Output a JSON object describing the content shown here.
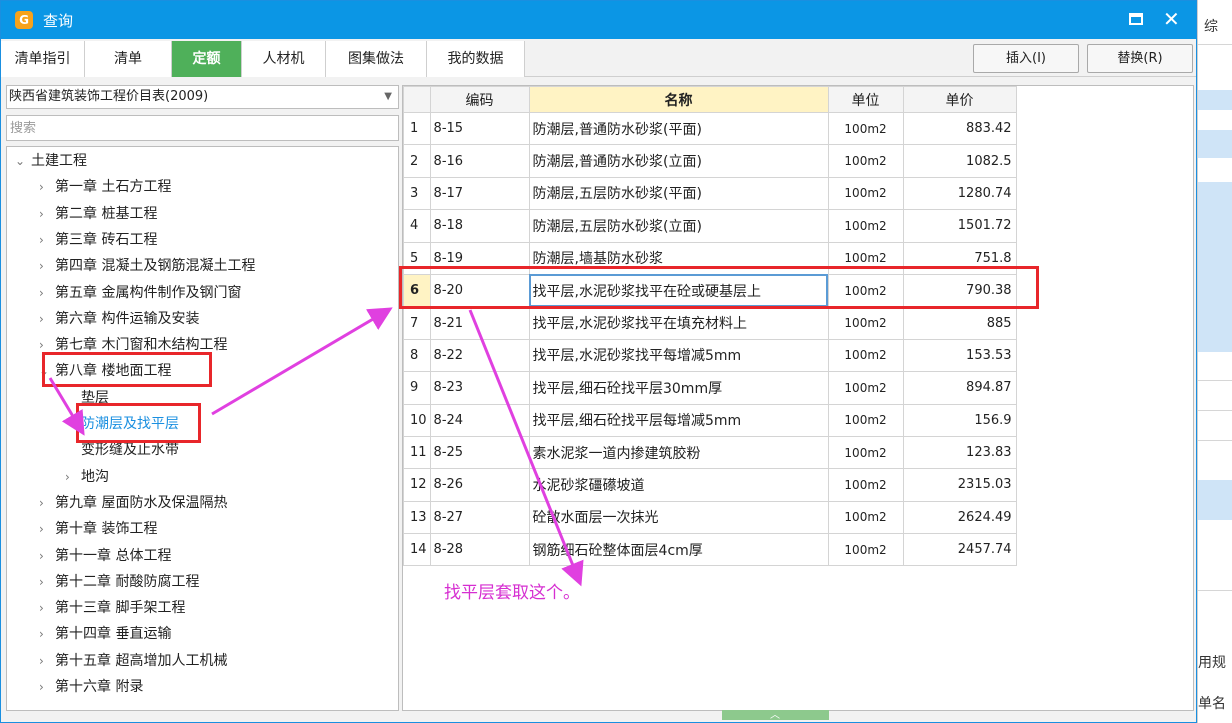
{
  "window": {
    "title": "查询"
  },
  "tabs": [
    {
      "label": "清单指引",
      "active": false
    },
    {
      "label": "清单",
      "active": false
    },
    {
      "label": "定额",
      "active": true
    },
    {
      "label": "人材机",
      "active": false
    },
    {
      "label": "图集做法",
      "active": false
    },
    {
      "label": "我的数据",
      "active": false
    }
  ],
  "actions": {
    "insert_label": "插入(I)",
    "replace_label": "替换(R)"
  },
  "library": {
    "selected": "陕西省建筑装饰工程价目表(2009)"
  },
  "search": {
    "placeholder": "搜索"
  },
  "tree": [
    {
      "label": "土建工程",
      "level": 0,
      "expanded": true
    },
    {
      "label": "第一章 土石方工程",
      "level": 1
    },
    {
      "label": "第二章 桩基工程",
      "level": 1
    },
    {
      "label": "第三章 砖石工程",
      "level": 1
    },
    {
      "label": "第四章 混凝土及钢筋混凝土工程",
      "level": 1
    },
    {
      "label": "第五章 金属构件制作及钢门窗",
      "level": 1
    },
    {
      "label": "第六章 构件运输及安装",
      "level": 1
    },
    {
      "label": "第七章 木门窗和木结构工程",
      "level": 1
    },
    {
      "label": "第八章 楼地面工程",
      "level": 1,
      "expanded": true
    },
    {
      "label": "垫层",
      "level": 2
    },
    {
      "label": "防潮层及找平层",
      "level": 2,
      "selected": true
    },
    {
      "label": "变形缝及止水带",
      "level": 2
    },
    {
      "label": "地沟",
      "level": 2,
      "has_children": true
    },
    {
      "label": "第九章 屋面防水及保温隔热",
      "level": 1
    },
    {
      "label": "第十章 装饰工程",
      "level": 1
    },
    {
      "label": "第十一章 总体工程",
      "level": 1
    },
    {
      "label": "第十二章 耐酸防腐工程",
      "level": 1
    },
    {
      "label": "第十三章 脚手架工程",
      "level": 1
    },
    {
      "label": "第十四章 垂直运输",
      "level": 1
    },
    {
      "label": "第十五章 超高增加人工机械",
      "level": 1
    },
    {
      "label": "第十六章 附录",
      "level": 1
    }
  ],
  "table": {
    "columns": [
      "编码",
      "名称",
      "单位",
      "单价"
    ],
    "rows": [
      {
        "idx": "1",
        "code": "8-15",
        "name": "防潮层,普通防水砂浆(平面)",
        "unit": "100m2",
        "price": "883.42"
      },
      {
        "idx": "2",
        "code": "8-16",
        "name": "防潮层,普通防水砂浆(立面)",
        "unit": "100m2",
        "price": "1082.5"
      },
      {
        "idx": "3",
        "code": "8-17",
        "name": "防潮层,五层防水砂浆(平面)",
        "unit": "100m2",
        "price": "1280.74"
      },
      {
        "idx": "4",
        "code": "8-18",
        "name": "防潮层,五层防水砂浆(立面)",
        "unit": "100m2",
        "price": "1501.72"
      },
      {
        "idx": "5",
        "code": "8-19",
        "name": "防潮层,墙基防水砂浆",
        "unit": "100m2",
        "price": "751.8"
      },
      {
        "idx": "6",
        "code": "8-20",
        "name": "找平层,水泥砂浆找平在砼或硬基层上",
        "unit": "100m2",
        "price": "790.38",
        "selected": true
      },
      {
        "idx": "7",
        "code": "8-21",
        "name": "找平层,水泥砂浆找平在填充材料上",
        "unit": "100m2",
        "price": "885"
      },
      {
        "idx": "8",
        "code": "8-22",
        "name": "找平层,水泥砂浆找平每增减5mm",
        "unit": "100m2",
        "price": "153.53"
      },
      {
        "idx": "9",
        "code": "8-23",
        "name": "找平层,细石砼找平层30mm厚",
        "unit": "100m2",
        "price": "894.87"
      },
      {
        "idx": "10",
        "code": "8-24",
        "name": "找平层,细石砼找平层每增减5mm",
        "unit": "100m2",
        "price": "156.9"
      },
      {
        "idx": "11",
        "code": "8-25",
        "name": "素水泥浆一道内掺建筑胶粉",
        "unit": "100m2",
        "price": "123.83"
      },
      {
        "idx": "12",
        "code": "8-26",
        "name": "水泥砂浆礓礤坡道",
        "unit": "100m2",
        "price": "2315.03"
      },
      {
        "idx": "13",
        "code": "8-27",
        "name": "砼散水面层一次抹光",
        "unit": "100m2",
        "price": "2624.49"
      },
      {
        "idx": "14",
        "code": "8-28",
        "name": "钢筋细石砼整体面层4cm厚",
        "unit": "100m2",
        "price": "2457.74"
      }
    ]
  },
  "annotation": {
    "note": "找平层套取这个。"
  },
  "background_app": {
    "tab_label": "综",
    "text_1": "用规",
    "text_2": "单名"
  },
  "colors": {
    "titlebar": "#0b96e5",
    "active_tab": "#4fb05a",
    "highlight": "#e8262a",
    "arrow": "#e040e0"
  }
}
